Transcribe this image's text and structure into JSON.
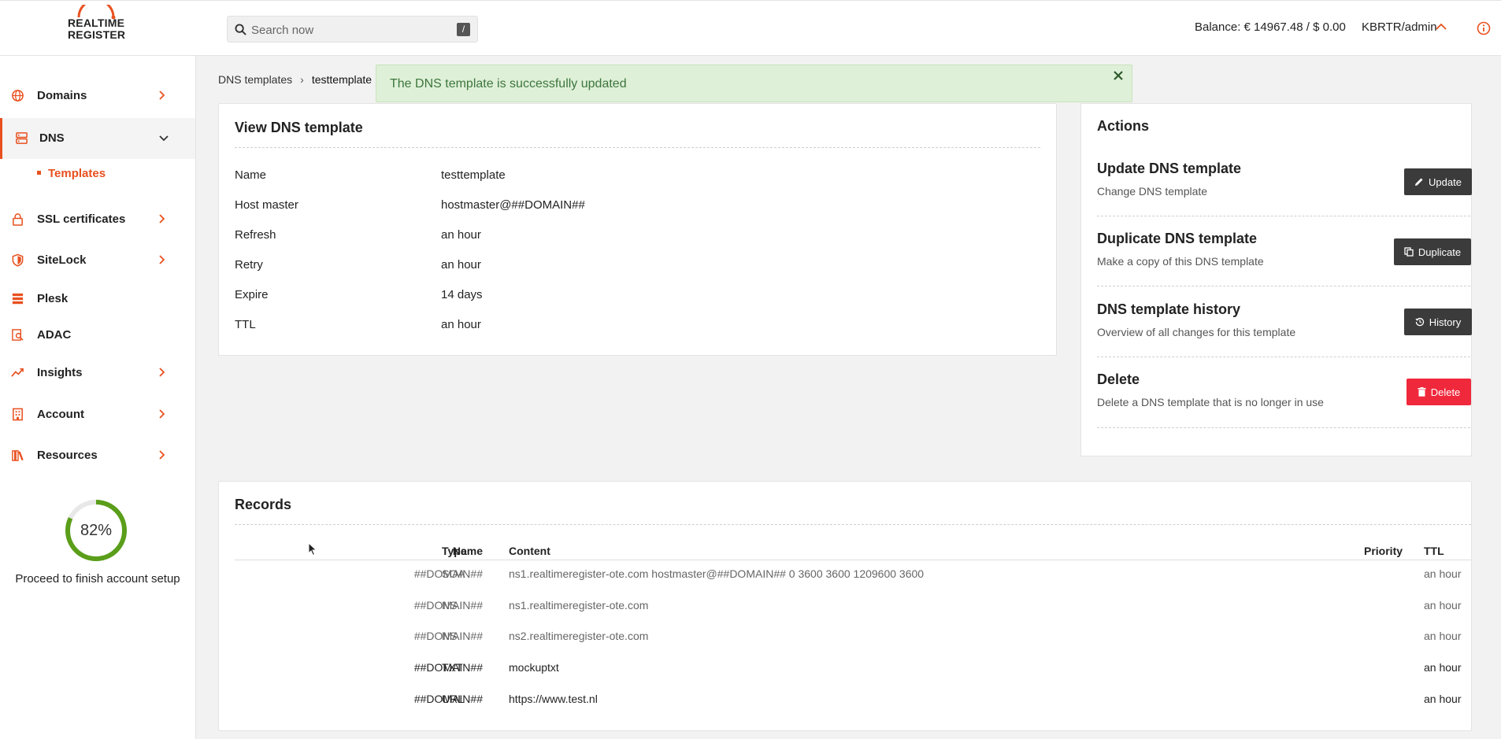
{
  "header": {
    "logo_line1": "REALTIME",
    "logo_line2": "REGISTER",
    "search_placeholder": "Search now",
    "search_shortcut": "/",
    "balance": "Balance: € 14967.48 / $ 0.00",
    "user": "KBRTR/admin"
  },
  "sidebar": {
    "items": [
      {
        "label": "Domains",
        "icon": "globe-icon"
      },
      {
        "label": "DNS",
        "icon": "server-icon"
      },
      {
        "label": "SSL certificates",
        "icon": "lock-icon"
      },
      {
        "label": "SiteLock",
        "icon": "shield-icon"
      },
      {
        "label": "Plesk",
        "icon": "stack-icon"
      },
      {
        "label": "ADAC",
        "icon": "search-doc-icon"
      },
      {
        "label": "Insights",
        "icon": "trend-icon"
      },
      {
        "label": "Account",
        "icon": "building-icon"
      },
      {
        "label": "Resources",
        "icon": "books-icon"
      }
    ],
    "dns_subitem": "Templates",
    "progress_value": 82,
    "progress_label": "82%",
    "progress_caption": "Proceed to finish account setup"
  },
  "breadcrumb": {
    "root": "DNS templates",
    "current": "testtemplate"
  },
  "alert": {
    "message": "The DNS template is successfully updated"
  },
  "view": {
    "title": "View DNS template",
    "fields": [
      {
        "label": "Name",
        "value": "testtemplate"
      },
      {
        "label": "Host master",
        "value": "hostmaster@##DOMAIN##"
      },
      {
        "label": "Refresh",
        "value": "an hour"
      },
      {
        "label": "Retry",
        "value": "an hour"
      },
      {
        "label": "Expire",
        "value": "14 days"
      },
      {
        "label": "TTL",
        "value": "an hour"
      }
    ]
  },
  "actions": {
    "title": "Actions",
    "items": [
      {
        "title": "Update DNS template",
        "desc": "Change DNS template",
        "button": "Update",
        "icon": "pencil-icon"
      },
      {
        "title": "Duplicate DNS template",
        "desc": "Make a copy of this DNS template",
        "button": "Duplicate",
        "icon": "copy-icon"
      },
      {
        "title": "DNS template history",
        "desc": "Overview of all changes for this template",
        "button": "History",
        "icon": "history-icon"
      },
      {
        "title": "Delete",
        "desc": "Delete a DNS template that is no longer in use",
        "button": "Delete",
        "icon": "trash-icon"
      }
    ]
  },
  "records": {
    "title": "Records",
    "columns": {
      "name": "Name",
      "type": "Type",
      "content": "Content",
      "priority": "Priority",
      "ttl": "TTL"
    },
    "rows": [
      {
        "name": "##DOMAIN##",
        "type": "SOA",
        "content": "ns1.realtimeregister-ote.com hostmaster@##DOMAIN## 0 3600 3600 1209600 3600",
        "priority": "",
        "ttl": "an hour"
      },
      {
        "name": "##DOMAIN##",
        "type": "NS",
        "content": "ns1.realtimeregister-ote.com",
        "priority": "",
        "ttl": "an hour"
      },
      {
        "name": "##DOMAIN##",
        "type": "NS",
        "content": "ns2.realtimeregister-ote.com",
        "priority": "",
        "ttl": "an hour"
      },
      {
        "name": "##DOMAIN##",
        "type": "TXT",
        "content": "mockuptxt",
        "priority": "",
        "ttl": "an hour"
      },
      {
        "name": "##DOMAIN##",
        "type": "URL",
        "content": "https://www.test.nl",
        "priority": "",
        "ttl": "an hour"
      }
    ]
  },
  "colors": {
    "accent": "#e8501f",
    "success_bg": "#dff0d8",
    "success_text": "#3c763d",
    "danger": "#f0283c",
    "dark_button": "#3b3b3b",
    "progress": "#5a9e1a"
  }
}
